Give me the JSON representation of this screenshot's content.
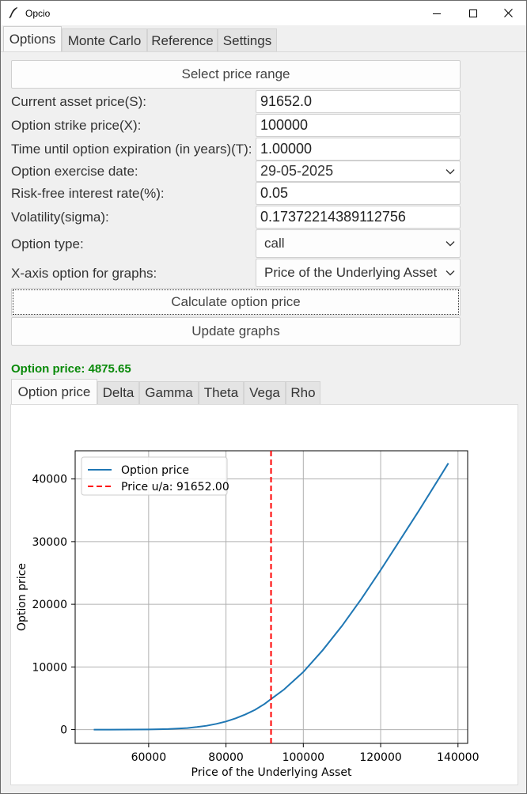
{
  "window": {
    "title": "Opcio"
  },
  "main_tabs": [
    {
      "label": "Options"
    },
    {
      "label": "Monte Carlo"
    },
    {
      "label": "Reference"
    },
    {
      "label": "Settings"
    }
  ],
  "form": {
    "select_range_label": "Select price range",
    "rows": [
      {
        "label": "Current asset price(S):",
        "value": "91652.0"
      },
      {
        "label": "Option strike price(X):",
        "value": "100000"
      },
      {
        "label": "Time until option expiration (in years)(T):",
        "value": "1.00000"
      },
      {
        "label": "Option exercise date:",
        "value": "29-05-2025"
      },
      {
        "label": "Risk-free interest rate(%):",
        "value": "0.05"
      },
      {
        "label": "Volatility(sigma):",
        "value": "0.17372214389112756"
      }
    ],
    "option_type_label": "Option type:",
    "option_type_value": "call",
    "xaxis_label": "X-axis option for graphs:",
    "xaxis_value": "Price of the Underlying Asset",
    "calculate_label": "Calculate option price",
    "update_label": "Update graphs"
  },
  "result": {
    "text": "Option price: 4875.65",
    "color": "#0a8a0a"
  },
  "graph_tabs": [
    {
      "label": "Option price"
    },
    {
      "label": "Delta"
    },
    {
      "label": "Gamma"
    },
    {
      "label": "Theta"
    },
    {
      "label": "Vega"
    },
    {
      "label": "Rho"
    }
  ],
  "chart_data": {
    "type": "line",
    "xlabel": "Price of the Underlying Asset",
    "ylabel": "Option price",
    "xlim": [
      41000,
      142500
    ],
    "ylim": [
      -2200,
      44500
    ],
    "xticks": [
      60000,
      80000,
      100000,
      120000,
      140000
    ],
    "yticks": [
      0,
      10000,
      20000,
      30000,
      40000
    ],
    "grid": true,
    "legend_position": "upper-left",
    "series": [
      {
        "name": "Option price",
        "color": "#1f77b4",
        "style": "solid",
        "x": [
          45800,
          50000,
          55000,
          60000,
          65000,
          70000,
          72500,
          75000,
          77500,
          80000,
          82500,
          85000,
          87500,
          90000,
          91652,
          95000,
          100000,
          105000,
          110000,
          115000,
          120000,
          125000,
          130000,
          135000,
          137500
        ],
        "y": [
          0,
          2,
          8,
          27,
          90,
          250,
          410,
          620,
          920,
          1300,
          1800,
          2420,
          3150,
          4100,
          4876,
          6400,
          9200,
          12650,
          16550,
          20850,
          25450,
          30250,
          35050,
          40000,
          42500
        ]
      },
      {
        "name": "Price u/a: 91652.00",
        "color": "#ff0000",
        "style": "dashed",
        "vline_x": 91652
      }
    ]
  }
}
